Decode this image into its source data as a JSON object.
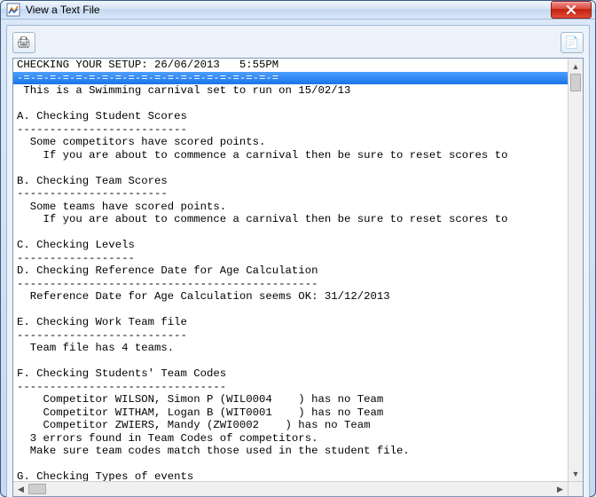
{
  "window": {
    "title": "View a Text File"
  },
  "toolbar": {
    "print_icon": "🖨",
    "right_icon": "📄"
  },
  "text": {
    "lines": [
      "CHECKING YOUR SETUP: 26/06/2013   5:55PM",
      "-=-=-=-=-=-=-=-=-=-=-=-=-=-=-=-=-=-=-=-=",
      " This is a Swimming carnival set to run on 15/02/13",
      "",
      "A. Checking Student Scores",
      "--------------------------",
      "  Some competitors have scored points.",
      "    If you are about to commence a carnival then be sure to reset scores to",
      "",
      "B. Checking Team Scores",
      "-----------------------",
      "  Some teams have scored points.",
      "    If you are about to commence a carnival then be sure to reset scores to",
      "",
      "C. Checking Levels",
      "------------------",
      "D. Checking Reference Date for Age Calculation",
      "----------------------------------------------",
      "  Reference Date for Age Calculation seems OK: 31/12/2013",
      "",
      "E. Checking Work Team file",
      "--------------------------",
      "  Team file has 4 teams.",
      "",
      "F. Checking Students' Team Codes",
      "--------------------------------",
      "    Competitor WILSON, Simon P (WIL0004    ) has no Team",
      "    Competitor WITHAM, Logan B (WIT0001    ) has no Team",
      "    Competitor ZWIERS, Mandy (ZWI0002    ) has no Team",
      "  3 errors found in Team Codes of competitors.",
      "  Make sure team codes match those used in the student file.",
      "",
      "G. Checking Types of events",
      "---------------------------"
    ],
    "highlight_index": 1
  }
}
